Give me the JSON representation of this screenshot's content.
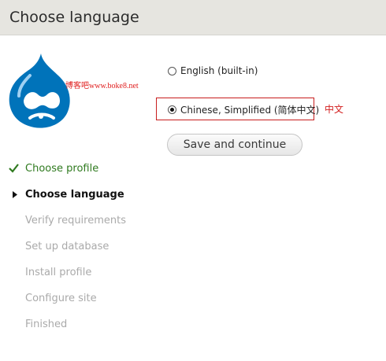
{
  "header": {
    "title": "Choose language"
  },
  "logo": {
    "icon": "drupal-drop-logo",
    "color": "#0073ba"
  },
  "watermark": {
    "text": "博客吧www.boke8.net"
  },
  "languages": [
    {
      "label": "English (built-in)",
      "selected": false
    },
    {
      "label": "Chinese, Simplified (简体中文)",
      "selected": true
    }
  ],
  "annotation": {
    "text": "中文",
    "color": "#d32020"
  },
  "save_button": {
    "label": "Save and continue"
  },
  "steps": [
    {
      "label": "Choose profile",
      "status": "done",
      "icon": "checkmark-icon"
    },
    {
      "label": "Choose language",
      "status": "active",
      "icon": "triangle-right-icon"
    },
    {
      "label": "Verify requirements",
      "status": "pending"
    },
    {
      "label": "Set up database",
      "status": "pending"
    },
    {
      "label": "Install profile",
      "status": "pending"
    },
    {
      "label": "Configure site",
      "status": "pending"
    },
    {
      "label": "Finished",
      "status": "pending"
    }
  ],
  "colors": {
    "header_bg": "#e6e5e0",
    "done": "#2f7a1f",
    "pending": "#aaaaaa",
    "highlight": "#c81e1e"
  }
}
